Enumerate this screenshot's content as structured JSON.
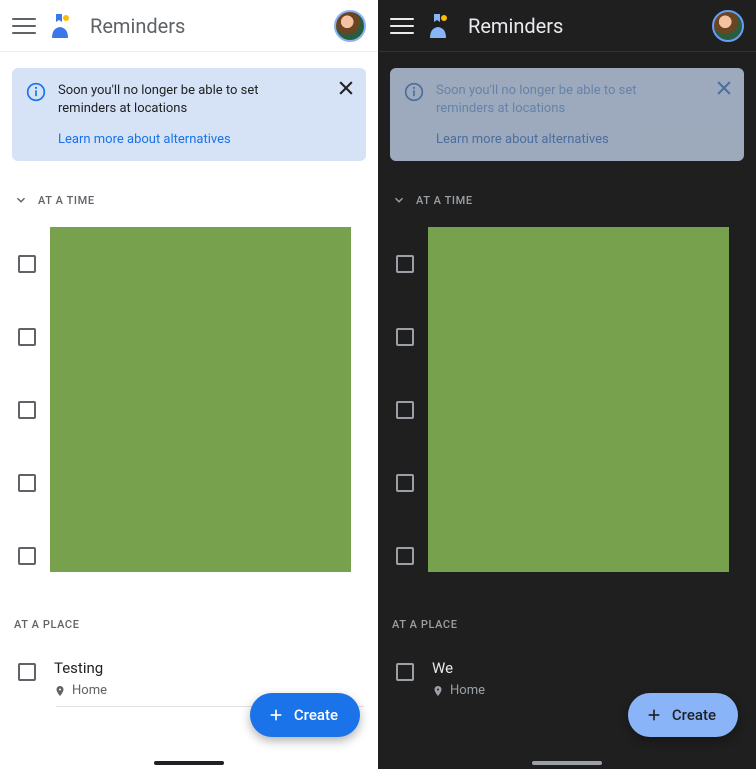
{
  "light": {
    "header": {
      "title": "Reminders"
    },
    "banner": {
      "message": "Soon you'll no longer be able to set reminders at locations",
      "link": "Learn more about alternatives"
    },
    "sections": {
      "time_label": "AT A TIME",
      "place_label": "AT A PLACE"
    },
    "place_item": {
      "title": "Testing",
      "location": "Home"
    },
    "fab_label": "Create",
    "time_rows": 5,
    "icons": {
      "menu": "menu-icon",
      "app": "reminders-app-icon",
      "avatar": "profile-avatar",
      "info": "info-icon",
      "close": "close-icon",
      "chevron": "chevron-down-icon",
      "pin": "location-pin-icon",
      "plus": "plus-icon"
    },
    "colors": {
      "accent": "#1a73e8",
      "banner_bg": "#d6e3f6"
    }
  },
  "dark": {
    "header": {
      "title": "Reminders"
    },
    "banner": {
      "message": "Soon you'll no longer be able to set reminders at locations",
      "link": "Learn more about alternatives"
    },
    "sections": {
      "time_label": "AT A TIME",
      "place_label": "AT A PLACE"
    },
    "place_item": {
      "title": "We",
      "location": "Home"
    },
    "fab_label": "Create",
    "time_rows": 5,
    "icons": {
      "menu": "menu-icon",
      "app": "reminders-app-icon",
      "avatar": "profile-avatar",
      "info": "info-icon",
      "close": "close-icon",
      "chevron": "chevron-down-icon",
      "pin": "location-pin-icon",
      "plus": "plus-icon"
    },
    "colors": {
      "accent": "#8ab4f8",
      "banner_bg": "#c7d9f2"
    }
  }
}
